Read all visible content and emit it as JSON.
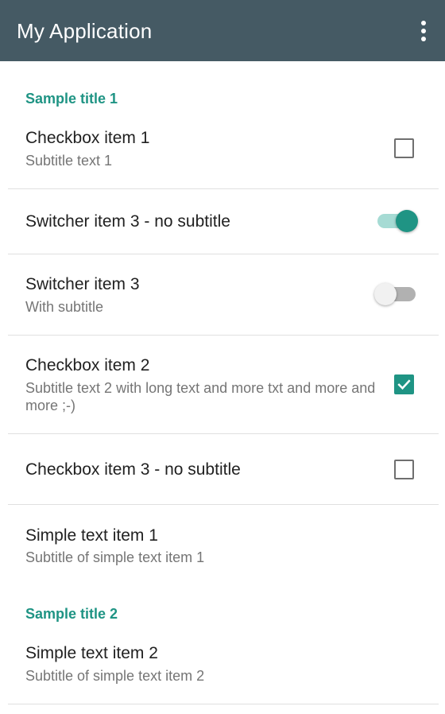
{
  "app_bar": {
    "title": "My Application",
    "menu_icon": "more-vert-icon",
    "background": "#455a64"
  },
  "accent_color": "#1f9484",
  "sections": [
    {
      "title": "Sample title 1",
      "items": [
        {
          "type": "checkbox",
          "title": "Checkbox item 1",
          "subtitle": "Subtitle text 1",
          "checked": false
        },
        {
          "type": "switch",
          "title": "Switcher item 3 - no subtitle",
          "on": true
        },
        {
          "type": "switch",
          "title": "Switcher item 3",
          "subtitle": "With subtitle",
          "on": false
        },
        {
          "type": "checkbox",
          "title": "Checkbox item 2",
          "subtitle": "Subtitle text 2 with long text and more txt and more and more ;-)",
          "checked": true
        },
        {
          "type": "checkbox",
          "title": "Checkbox item 3 - no subtitle",
          "checked": false
        },
        {
          "type": "text",
          "title": "Simple text item 1",
          "subtitle": "Subtitle of simple text item 1"
        }
      ]
    },
    {
      "title": "Sample title 2",
      "items": [
        {
          "type": "text",
          "title": "Simple text item 2",
          "subtitle": "Subtitle of simple text item 2"
        }
      ]
    }
  ]
}
